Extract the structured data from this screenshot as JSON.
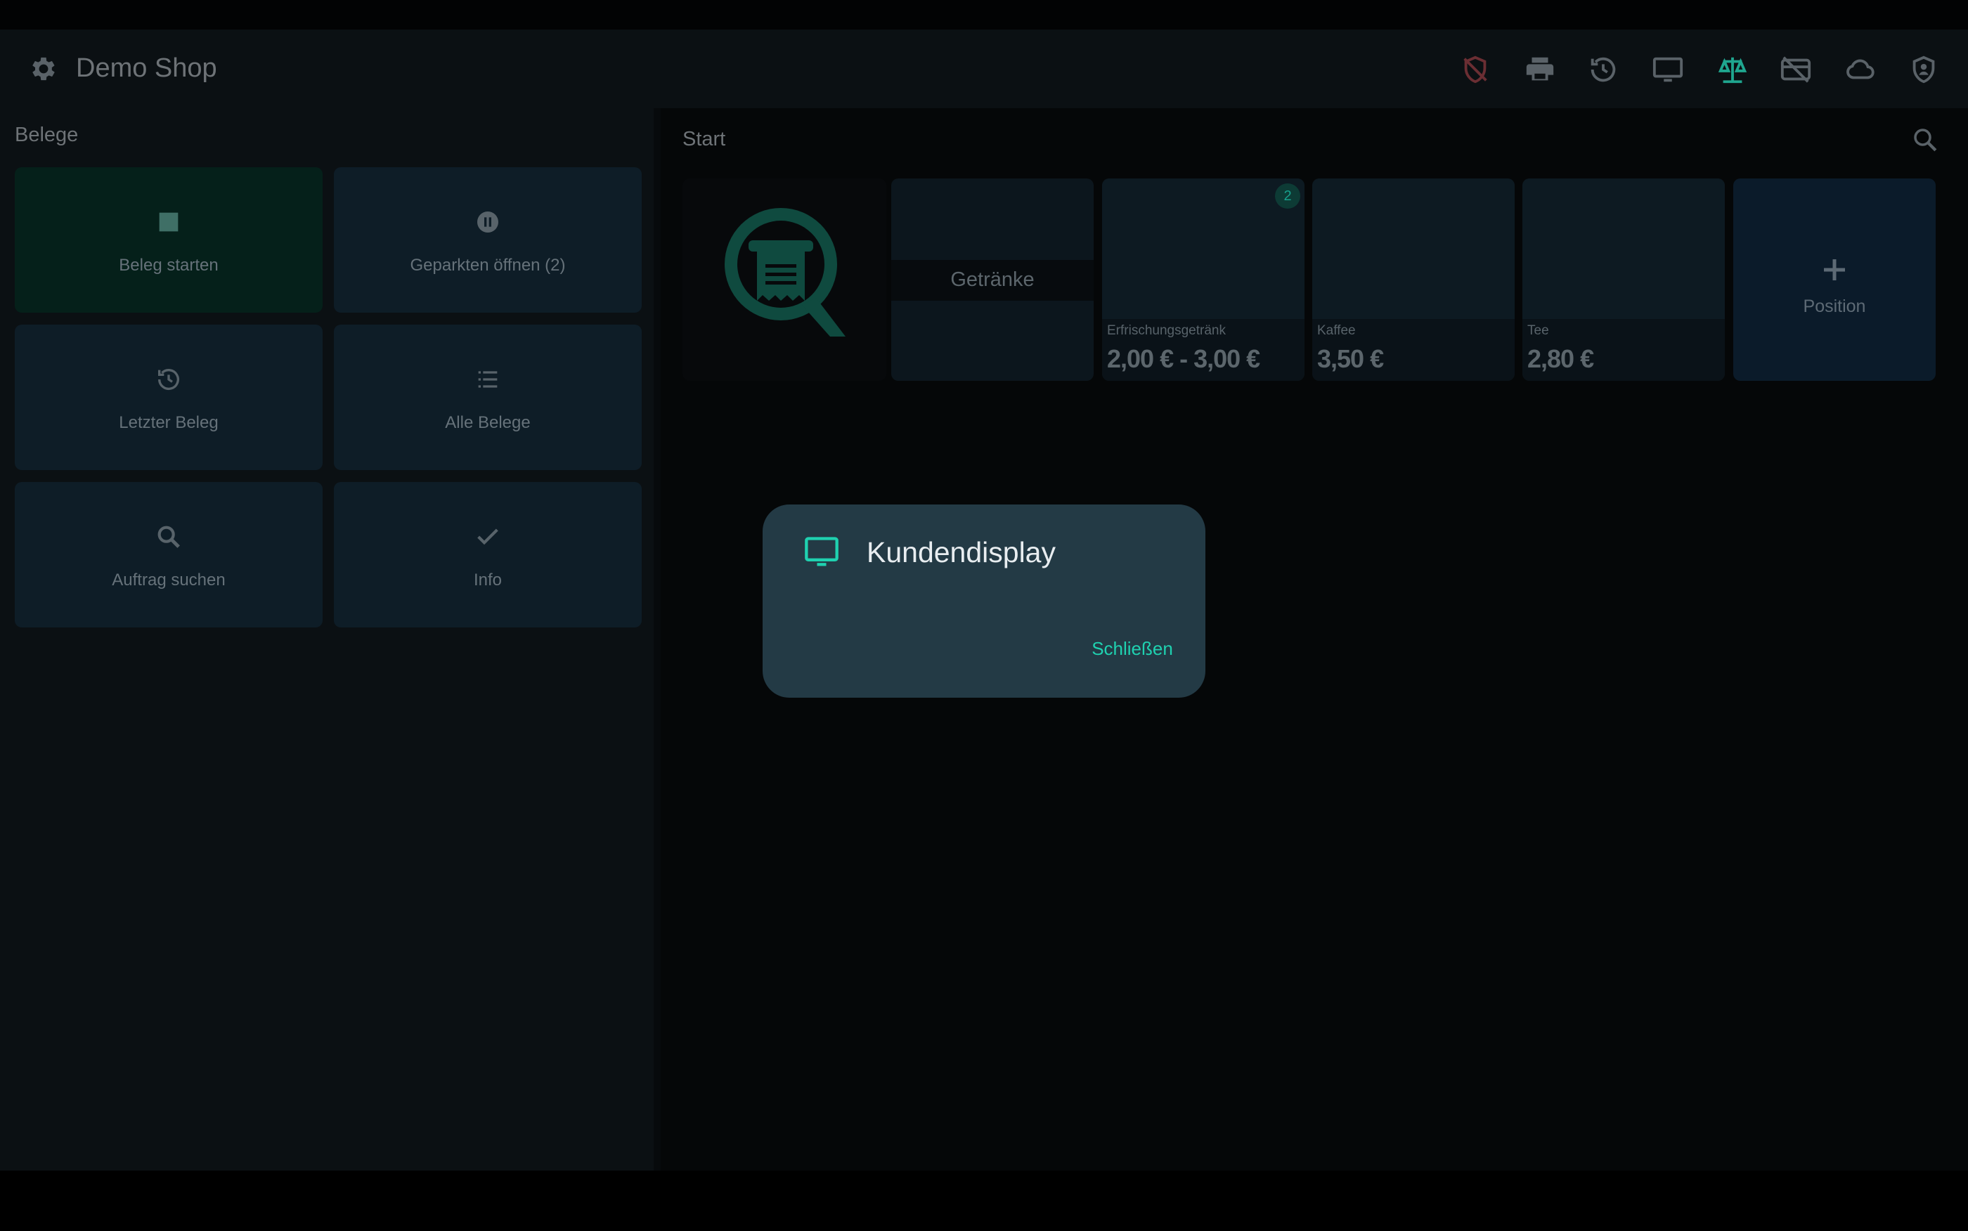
{
  "appbar": {
    "title": "Demo Shop",
    "icons": [
      "shield-off-icon",
      "printer-icon",
      "history-icon",
      "monitor-icon",
      "scale-icon",
      "card-off-icon",
      "cloud-icon",
      "shield-user-icon"
    ],
    "colors": {
      "scale": "#1fa68f",
      "shield_off": "#6b2e33",
      "default": "#5a6268"
    }
  },
  "left_panel": {
    "title": "Belege",
    "tiles": [
      {
        "label": "Beleg starten",
        "icon": "stop-square-icon",
        "color": "#05201a"
      },
      {
        "label": "Geparkten öffnen (2)",
        "icon": "pause-circle-icon"
      },
      {
        "label": "Letzter Beleg",
        "icon": "history-icon"
      },
      {
        "label": "Alle Belege",
        "icon": "list-icon"
      },
      {
        "label": "Auftrag suchen",
        "icon": "search-icon"
      },
      {
        "label": "Info",
        "icon": "check-icon"
      }
    ]
  },
  "main": {
    "title": "Start",
    "category": {
      "label": "Getränke"
    },
    "products": [
      {
        "name": "Erfrischungsgetränk",
        "price": "2,00 € - 3,00 €",
        "badge": "2"
      },
      {
        "name": "Kaffee",
        "price": "3,50 €"
      },
      {
        "name": "Tee",
        "price": "2,80 €"
      }
    ],
    "add_position": {
      "label": "Position",
      "icon": "plus-icon"
    }
  },
  "dialog": {
    "title": "Kundendisplay",
    "icon": "monitor-icon",
    "close_label": "Schließen",
    "accent": "#1fd1b0"
  }
}
